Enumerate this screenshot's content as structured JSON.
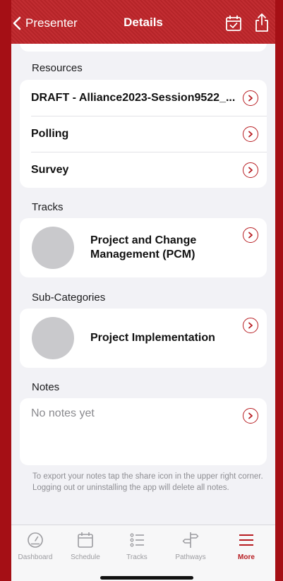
{
  "nav": {
    "back_label": "Presenter",
    "title": "Details",
    "back_icon": "chevron-left-icon",
    "calendar_icon": "calendar-check-icon",
    "share_icon": "share-icon"
  },
  "sections": {
    "resources": {
      "header": "Resources",
      "items": [
        {
          "label": "DRAFT - Alliance2023-Session9522_..."
        },
        {
          "label": "Polling"
        },
        {
          "label": "Survey"
        }
      ]
    },
    "tracks": {
      "header": "Tracks",
      "items": [
        {
          "line1": "Project and Change",
          "line2": "Management (PCM)"
        }
      ]
    },
    "subcategories": {
      "header": "Sub-Categories",
      "items": [
        {
          "label": "Project Implementation"
        }
      ]
    },
    "notes": {
      "header": "Notes",
      "placeholder": "No notes yet",
      "hint": "To export your notes tap the share icon in the upper right corner. Logging out or uninstalling the app will delete all notes."
    }
  },
  "tab_bar": {
    "items": [
      {
        "label": "Dashboard",
        "icon": "dashboard-gauge-icon"
      },
      {
        "label": "Schedule",
        "icon": "calendar-icon"
      },
      {
        "label": "Tracks",
        "icon": "list-icon"
      },
      {
        "label": "Pathways",
        "icon": "signpost-icon"
      },
      {
        "label": "More",
        "icon": "menu-icon",
        "active": true
      }
    ]
  },
  "colors": {
    "accent": "#b71c21",
    "nav_bg": "#c0262b",
    "frame": "#a50f15",
    "background": "#f2f2f6"
  }
}
